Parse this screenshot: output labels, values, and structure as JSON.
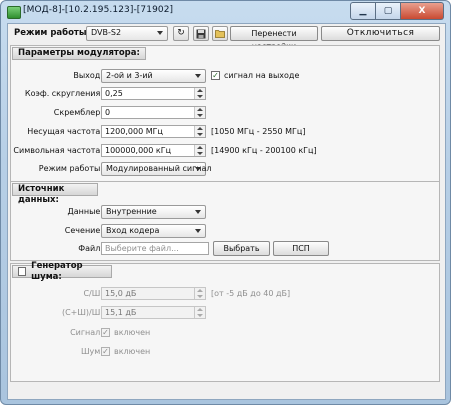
{
  "window": {
    "title": "[МОД-8]-[10.2.195.123]-[71902]",
    "controls": {
      "close_glyph": "X"
    }
  },
  "toolbar": {
    "mode_label": "Режим работы:",
    "mode_value": "DVB-S2",
    "transfer_button": "Перенести настройки",
    "disconnect_button": "Отключиться"
  },
  "modulator": {
    "title": "Параметры модулятора:",
    "output": {
      "label": "Выход:",
      "value": "2-ой и 3-ий",
      "checkbox_label": "сигнал на выходе",
      "checked": true
    },
    "rolloff": {
      "label": "Коэф. скругления:",
      "value": "0,25"
    },
    "scrambler": {
      "label": "Скремблер:",
      "value": "0"
    },
    "carrier": {
      "label": "Несущая частота:",
      "value": "1200,000 МГц",
      "range": "[1050 МГц - 2550 МГц]"
    },
    "symbol_rate": {
      "label": "Символьная частота:",
      "value": "100000,000 кГц",
      "range": "[14900 кГц - 200100 кГц]"
    },
    "mode": {
      "label": "Режим работы:",
      "value": "Модулированный сигнал"
    }
  },
  "source": {
    "title": "Источник данных:",
    "data": {
      "label": "Данные:",
      "value": "Внутренние"
    },
    "section": {
      "label": "Сечение:",
      "value": "Вход кодера"
    },
    "file": {
      "label": "Файл:",
      "placeholder": "Выберите файл...",
      "choose_button": "Выбрать",
      "psp_button": "ПСП"
    }
  },
  "noise": {
    "title": "Генератор шума:",
    "enabled": false,
    "snr": {
      "label": "С/Ш:",
      "value": "15,0 дБ",
      "range": "[от -5 дБ до 40 дБ]"
    },
    "snr_total": {
      "label": "(С+Ш)/Ш:",
      "value": "15,1 дБ"
    },
    "signal": {
      "label": "Сигнал:",
      "checkbox_label": "включен",
      "checked": true
    },
    "noise": {
      "label": "Шум:",
      "checkbox_label": "включен",
      "checked": true
    }
  },
  "colors": {
    "accent": "#2f8f2f",
    "title_gradient_top": "#c7dcef",
    "close_button": "#c94a32"
  },
  "icons": {
    "app": "app-icon",
    "refresh": "refresh-icon",
    "save": "save-icon",
    "open": "folder-open-icon"
  }
}
